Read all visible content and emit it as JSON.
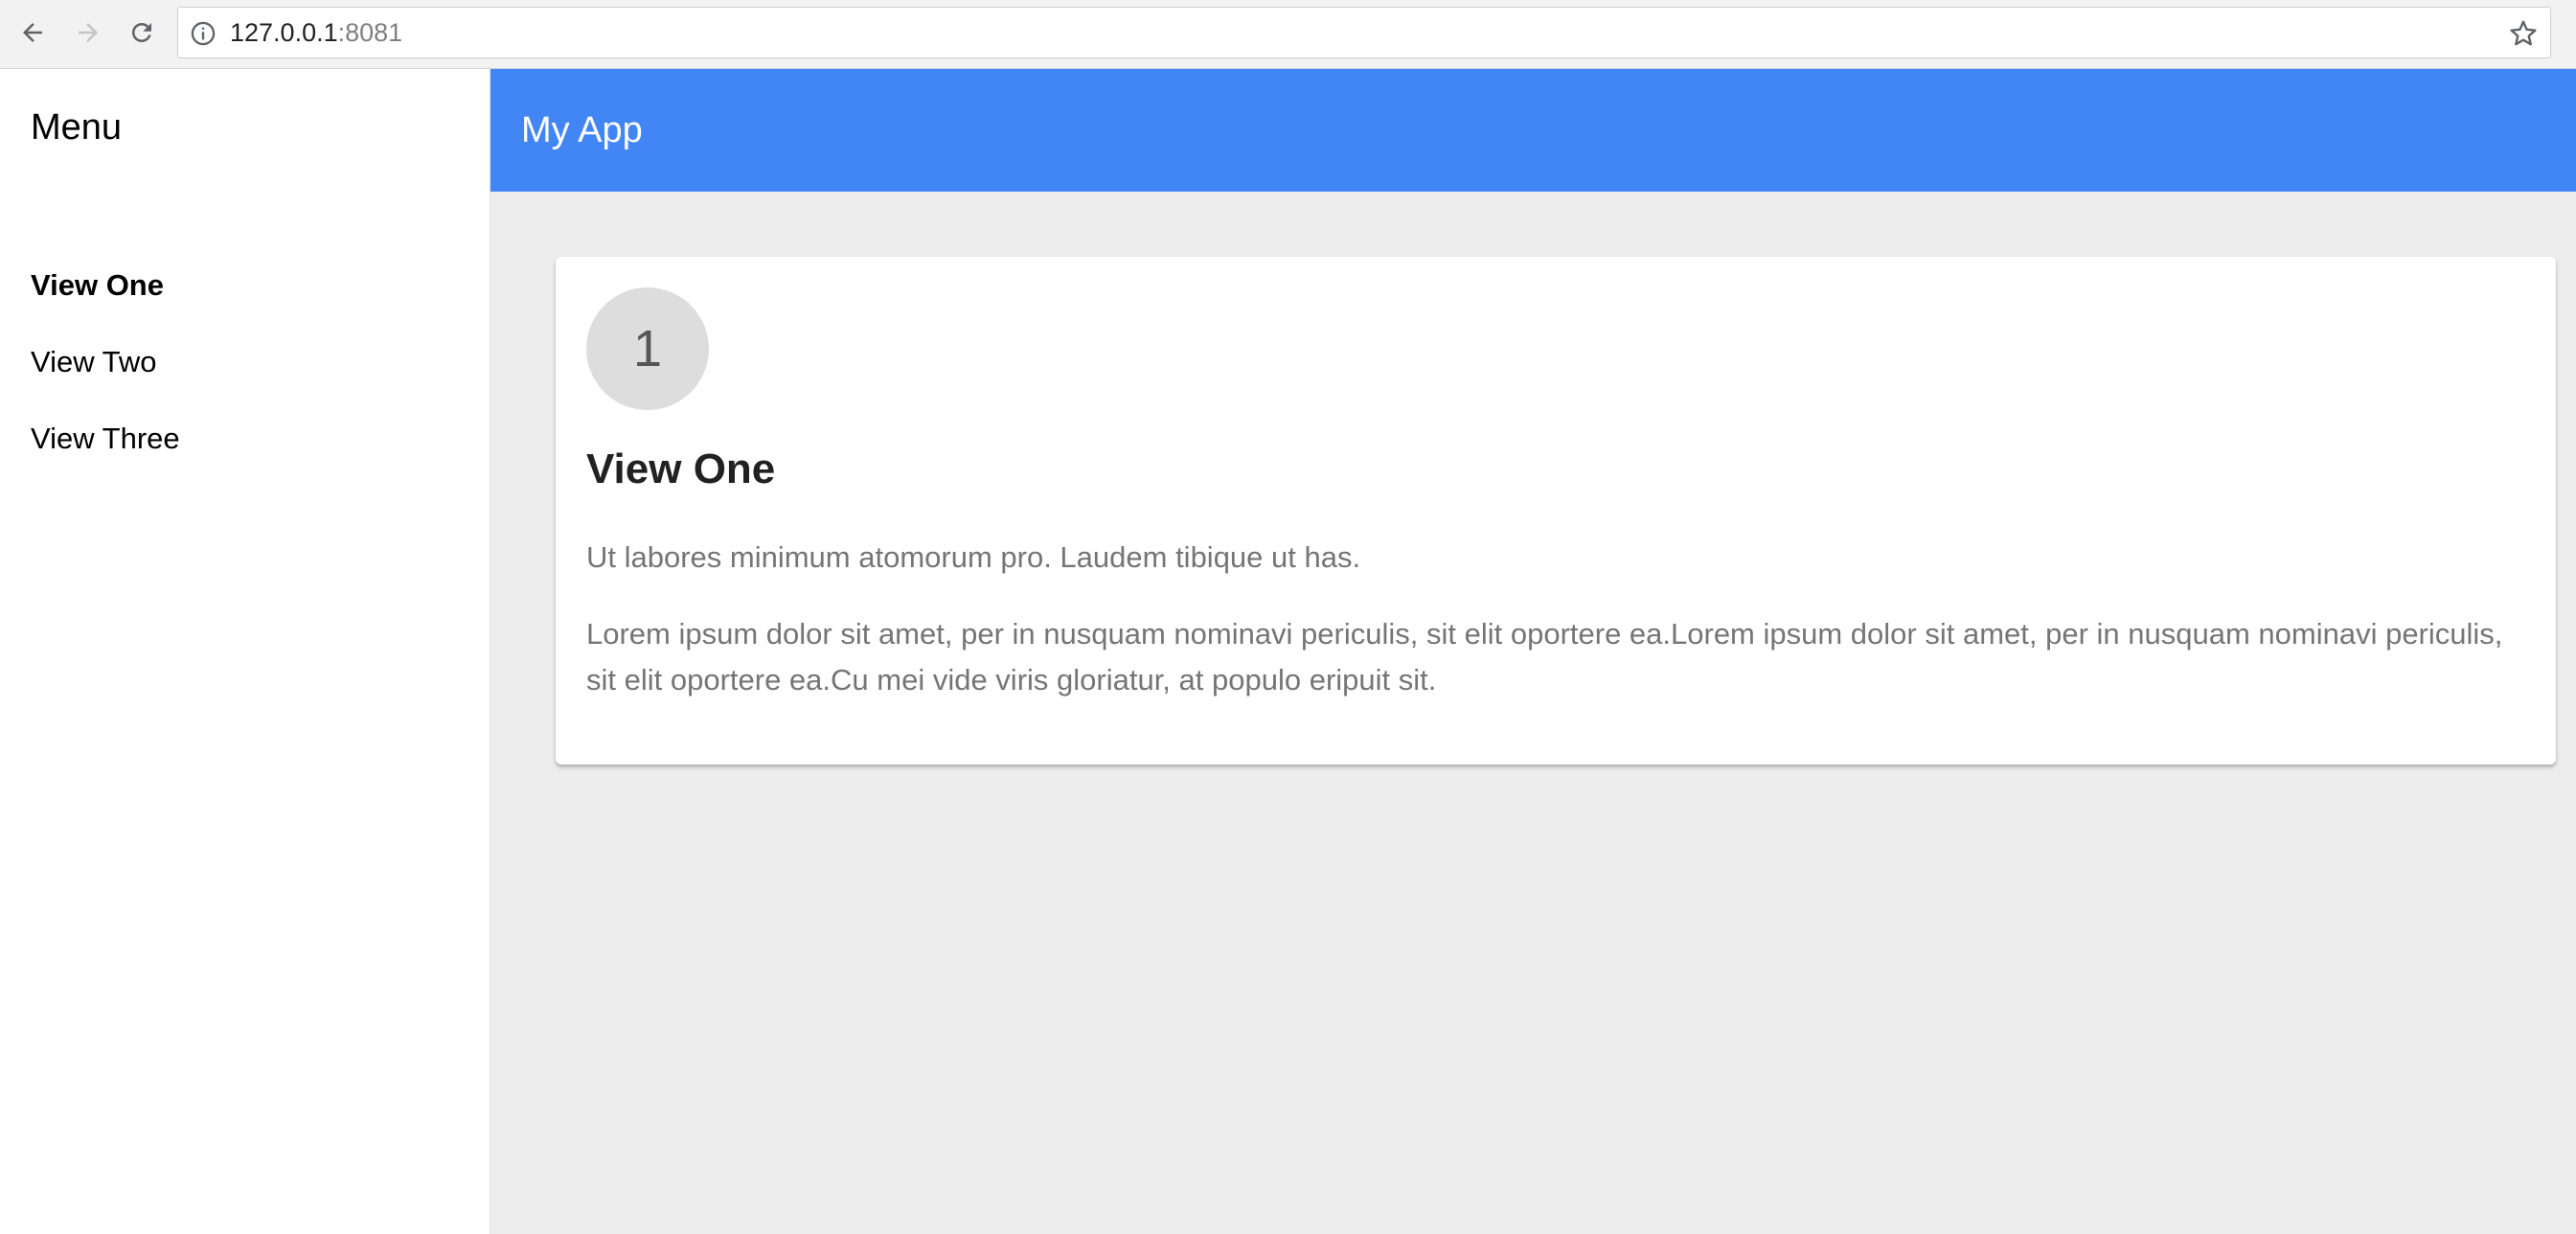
{
  "browser": {
    "url_host": "127.0.0.1",
    "url_port": ":8081"
  },
  "sidebar": {
    "title": "Menu",
    "items": [
      {
        "label": "View One",
        "active": true
      },
      {
        "label": "View Two",
        "active": false
      },
      {
        "label": "View Three",
        "active": false
      }
    ]
  },
  "header": {
    "title": "My App",
    "color": "#4285f4"
  },
  "card": {
    "badge": "1",
    "title": "View One",
    "paragraphs": [
      "Ut labores minimum atomorum pro. Laudem tibique ut has.",
      "Lorem ipsum dolor sit amet, per in nusquam nominavi periculis, sit elit oportere ea.Lorem ipsum dolor sit amet, per in nusquam nominavi periculis, sit elit oportere ea.Cu mei vide viris gloriatur, at populo eripuit sit."
    ]
  },
  "icons": {
    "back": "arrow-left-icon",
    "forward": "arrow-right-icon",
    "reload": "reload-icon",
    "info": "info-icon",
    "bookmark": "star-icon"
  }
}
